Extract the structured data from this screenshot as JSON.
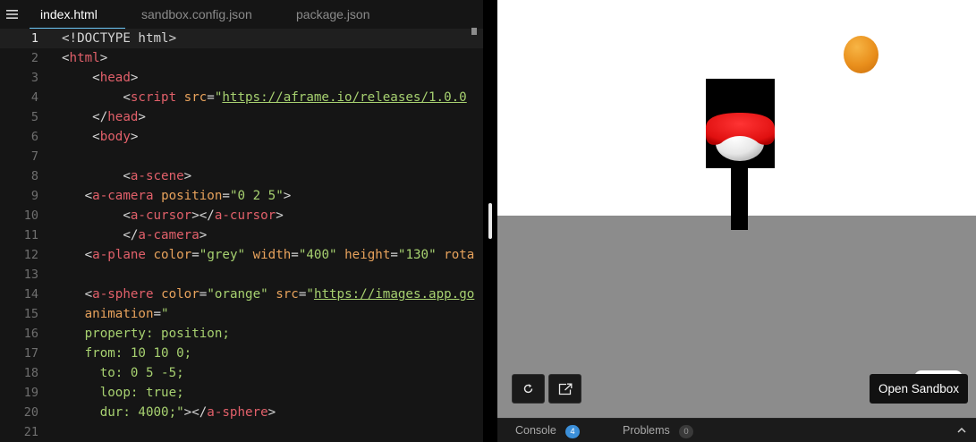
{
  "tabs": [
    {
      "label": "index.html",
      "active": true
    },
    {
      "label": "sandbox.config.json",
      "active": false
    },
    {
      "label": "package.json",
      "active": false
    }
  ],
  "editor": {
    "current_line": 1,
    "lines": [
      {
        "n": "1",
        "tokens": [
          {
            "t": "txt",
            "v": "<!DOCTYPE html>"
          }
        ]
      },
      {
        "n": "2",
        "tokens": [
          {
            "t": "txt",
            "v": "<"
          },
          {
            "t": "tag",
            "v": "html"
          },
          {
            "t": "txt",
            "v": ">"
          }
        ]
      },
      {
        "n": "3",
        "tokens": [
          {
            "t": "txt",
            "v": "    <"
          },
          {
            "t": "tag",
            "v": "head"
          },
          {
            "t": "txt",
            "v": ">"
          }
        ]
      },
      {
        "n": "4",
        "tokens": [
          {
            "t": "txt",
            "v": "        <"
          },
          {
            "t": "tag",
            "v": "script"
          },
          {
            "t": "txt",
            "v": " "
          },
          {
            "t": "attr",
            "v": "src"
          },
          {
            "t": "txt",
            "v": "="
          },
          {
            "t": "str",
            "v": "\""
          },
          {
            "t": "url",
            "v": "https://aframe.io/releases/1.0.0"
          }
        ]
      },
      {
        "n": "5",
        "tokens": [
          {
            "t": "txt",
            "v": "    </"
          },
          {
            "t": "tag",
            "v": "head"
          },
          {
            "t": "txt",
            "v": ">"
          }
        ]
      },
      {
        "n": "6",
        "tokens": [
          {
            "t": "txt",
            "v": "    <"
          },
          {
            "t": "tag",
            "v": "body"
          },
          {
            "t": "txt",
            "v": ">"
          }
        ]
      },
      {
        "n": "7",
        "tokens": []
      },
      {
        "n": "8",
        "tokens": [
          {
            "t": "txt",
            "v": "        <"
          },
          {
            "t": "tag",
            "v": "a-scene"
          },
          {
            "t": "txt",
            "v": ">"
          }
        ]
      },
      {
        "n": "9",
        "tokens": [
          {
            "t": "txt",
            "v": "   <"
          },
          {
            "t": "tag",
            "v": "a-camera"
          },
          {
            "t": "txt",
            "v": " "
          },
          {
            "t": "attr",
            "v": "position"
          },
          {
            "t": "txt",
            "v": "="
          },
          {
            "t": "str",
            "v": "\"0 2 5\""
          },
          {
            "t": "txt",
            "v": ">"
          }
        ]
      },
      {
        "n": "10",
        "tokens": [
          {
            "t": "txt",
            "v": "        <"
          },
          {
            "t": "tag",
            "v": "a-cursor"
          },
          {
            "t": "txt",
            "v": "></"
          },
          {
            "t": "tag",
            "v": "a-cursor"
          },
          {
            "t": "txt",
            "v": ">"
          }
        ]
      },
      {
        "n": "11",
        "tokens": [
          {
            "t": "txt",
            "v": "        </"
          },
          {
            "t": "tag",
            "v": "a-camera"
          },
          {
            "t": "txt",
            "v": ">"
          }
        ]
      },
      {
        "n": "12",
        "tokens": [
          {
            "t": "txt",
            "v": "   <"
          },
          {
            "t": "tag",
            "v": "a-plane"
          },
          {
            "t": "txt",
            "v": " "
          },
          {
            "t": "attr",
            "v": "color"
          },
          {
            "t": "txt",
            "v": "="
          },
          {
            "t": "str",
            "v": "\"grey\""
          },
          {
            "t": "txt",
            "v": " "
          },
          {
            "t": "attr",
            "v": "width"
          },
          {
            "t": "txt",
            "v": "="
          },
          {
            "t": "str",
            "v": "\"400\""
          },
          {
            "t": "txt",
            "v": " "
          },
          {
            "t": "attr",
            "v": "height"
          },
          {
            "t": "txt",
            "v": "="
          },
          {
            "t": "str",
            "v": "\"130\""
          },
          {
            "t": "txt",
            "v": " "
          },
          {
            "t": "attr",
            "v": "rota"
          }
        ]
      },
      {
        "n": "13",
        "tokens": []
      },
      {
        "n": "14",
        "tokens": [
          {
            "t": "txt",
            "v": "   <"
          },
          {
            "t": "tag",
            "v": "a-sphere"
          },
          {
            "t": "txt",
            "v": " "
          },
          {
            "t": "attr",
            "v": "color"
          },
          {
            "t": "txt",
            "v": "="
          },
          {
            "t": "str",
            "v": "\"orange\""
          },
          {
            "t": "txt",
            "v": " "
          },
          {
            "t": "attr",
            "v": "src"
          },
          {
            "t": "txt",
            "v": "="
          },
          {
            "t": "str",
            "v": "\""
          },
          {
            "t": "url",
            "v": "https://images.app.go"
          }
        ]
      },
      {
        "n": "15",
        "tokens": [
          {
            "t": "txt",
            "v": "   "
          },
          {
            "t": "attr",
            "v": "animation"
          },
          {
            "t": "txt",
            "v": "="
          },
          {
            "t": "str",
            "v": "\""
          }
        ]
      },
      {
        "n": "16",
        "tokens": [
          {
            "t": "css",
            "v": "   property: position;"
          }
        ]
      },
      {
        "n": "17",
        "tokens": [
          {
            "t": "css",
            "v": "   from: 10 10 0;"
          }
        ]
      },
      {
        "n": "18",
        "tokens": [
          {
            "t": "css",
            "v": "     to: 0 5 -5;"
          }
        ]
      },
      {
        "n": "19",
        "tokens": [
          {
            "t": "css",
            "v": "     loop: true;"
          }
        ]
      },
      {
        "n": "20",
        "tokens": [
          {
            "t": "css",
            "v": "     dur: 4000;"
          },
          {
            "t": "str",
            "v": "\""
          },
          {
            "t": "txt",
            "v": "></"
          },
          {
            "t": "tag",
            "v": "a-sphere"
          },
          {
            "t": "txt",
            "v": ">"
          }
        ]
      },
      {
        "n": "21",
        "tokens": []
      }
    ]
  },
  "preview": {
    "sky_color": "#ffffff",
    "ground_color": "#8c8c8c",
    "sphere_color": "#e98f1c",
    "open_sandbox_label": "Open Sandbox",
    "refresh_icon": "refresh-icon",
    "new_window_icon": "external-link-icon"
  },
  "bottom": {
    "console_label": "Console",
    "console_count": "4",
    "problems_label": "Problems",
    "problems_count": "0"
  },
  "colors": {
    "tag": "#e1606a",
    "attr": "#e7a25c",
    "string": "#a7d170",
    "accent": "#6cc7f6",
    "badge_blue": "#3b8fd9"
  }
}
